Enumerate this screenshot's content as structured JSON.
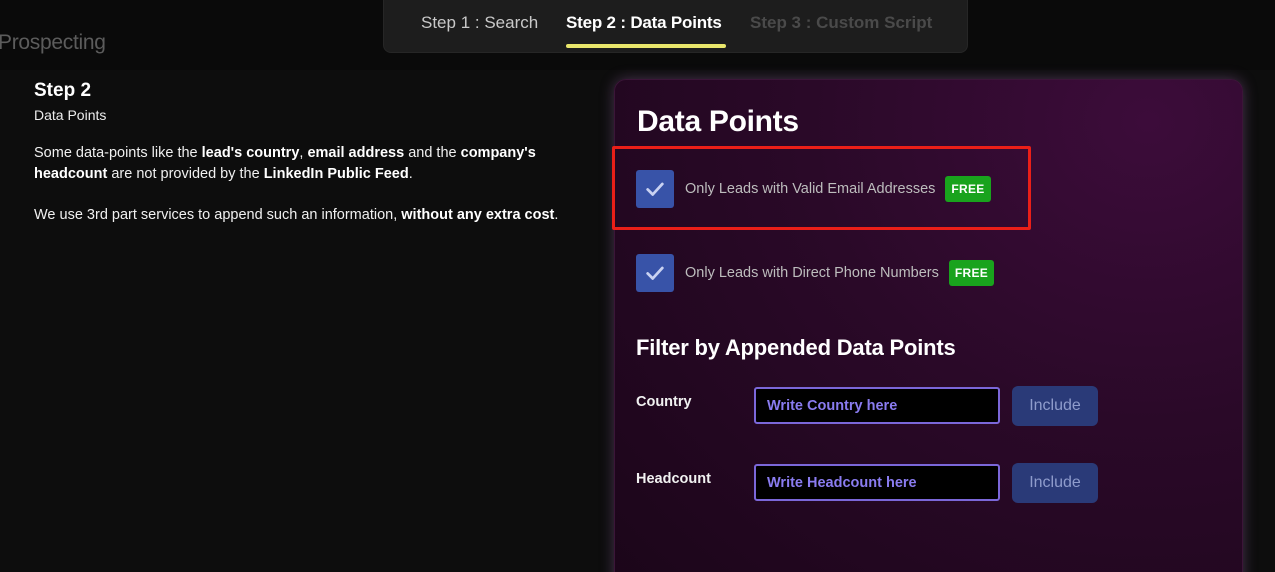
{
  "page": {
    "heading": "Prospecting"
  },
  "stepper": {
    "steps": [
      {
        "label": "Step 1 : Search",
        "state": "completed"
      },
      {
        "label": "Step 2 : Data Points",
        "state": "active"
      },
      {
        "label": "Step 3 : Custom Script",
        "state": "disabled"
      }
    ],
    "active_underline_color": "#e9e66b"
  },
  "info": {
    "title": "Step 2",
    "subtitle": "Data Points",
    "p1": {
      "t1": "Some data-points like the ",
      "b1": "lead's country",
      "t2": ", ",
      "b2": "email address",
      "t3": " and the ",
      "b3": "company's headcount",
      "t4": " are not provided by the ",
      "b4": "LinkedIn Public Feed",
      "t5": "."
    },
    "p2": {
      "t1": "We use 3rd part services to append such an information, ",
      "b1": "without any extra cost",
      "t2": "."
    }
  },
  "data_points": {
    "title": "Data Points",
    "options": [
      {
        "label": "Only Leads with Valid Email Addresses",
        "badge": "FREE",
        "checked": true
      },
      {
        "label": "Only Leads with Direct Phone Numbers",
        "badge": "FREE",
        "checked": true
      }
    ],
    "filter_section_title": "Filter by Appended Data Points",
    "filters": {
      "country": {
        "label": "Country",
        "placeholder": "Write Country here",
        "button": "Include"
      },
      "headcount": {
        "label": "Headcount",
        "placeholder": "Write Headcount here",
        "button": "Include"
      }
    }
  },
  "colors": {
    "checkbox": "#3853a8",
    "badge_free": "#19a31d",
    "highlight": "#ea1f18",
    "input_border": "#7b67d9",
    "include_button": "#2a3a78"
  }
}
